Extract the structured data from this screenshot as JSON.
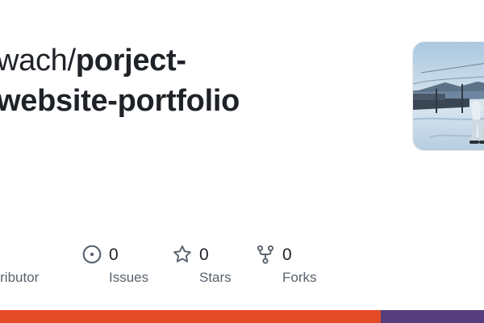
{
  "repo": {
    "owner": "wach",
    "separator": "/",
    "name_line1": "porject-",
    "name_line2": "website-portfolio"
  },
  "avatar": {
    "alt": "owner avatar photo"
  },
  "stats": {
    "contributors": {
      "label": "contributor",
      "icon": "people-icon"
    },
    "issues": {
      "count": "0",
      "label": "Issues",
      "icon": "issue-opened-icon"
    },
    "stars": {
      "count": "0",
      "label": "Stars",
      "icon": "star-icon"
    },
    "forks": {
      "count": "0",
      "label": "Forks",
      "icon": "repo-forked-icon"
    }
  },
  "languages": [
    {
      "color": "#e34c26",
      "fraction": 0.787
    },
    {
      "color": "#563d7c",
      "fraction": 0.213
    }
  ],
  "colors": {
    "text_primary": "#1f2328",
    "text_secondary": "#59636e",
    "icon": "#59636e"
  }
}
